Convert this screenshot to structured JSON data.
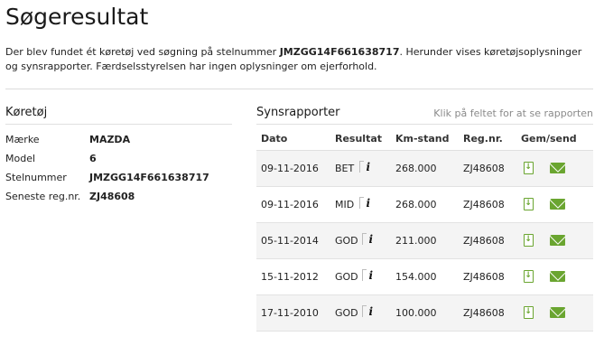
{
  "page": {
    "title": "Søgeresultat",
    "intro_part1": "Der blev fundet ét køretøj ved søgning på stelnummer ",
    "intro_vin": "JMZGG14F661638717",
    "intro_part2": ". Herunder vises køretøjsoplysninger og synsrapporter. Færdselsstyrelsen har ingen oplysninger om ejerforhold."
  },
  "vehicle": {
    "title": "Køretøj",
    "rows": [
      {
        "label": "Mærke",
        "value": "MAZDA"
      },
      {
        "label": "Model",
        "value": "6"
      },
      {
        "label": "Stelnummer",
        "value": "JMZGG14F661638717"
      },
      {
        "label": "Seneste reg.nr.",
        "value": "ZJ48608"
      }
    ]
  },
  "reports": {
    "title": "Synsrapporter",
    "hint": "Klik på feltet for at se rapporten",
    "headers": {
      "date": "Dato",
      "result": "Resultat",
      "km": "Km-stand",
      "reg": "Reg.nr.",
      "save": "Gem/send"
    },
    "info_glyph": "i",
    "icons": {
      "save": "document-download-icon",
      "send": "envelope-icon",
      "info": "info-icon"
    },
    "accent_color": "#6aa530",
    "rows": [
      {
        "date": "09-11-2016",
        "result": "BET",
        "km": "268.000",
        "reg": "ZJ48608"
      },
      {
        "date": "09-11-2016",
        "result": "MID",
        "km": "268.000",
        "reg": "ZJ48608"
      },
      {
        "date": "05-11-2014",
        "result": "GOD",
        "km": "211.000",
        "reg": "ZJ48608"
      },
      {
        "date": "15-11-2012",
        "result": "GOD",
        "km": "154.000",
        "reg": "ZJ48608"
      },
      {
        "date": "17-11-2010",
        "result": "GOD",
        "km": "100.000",
        "reg": "ZJ48608"
      }
    ]
  }
}
